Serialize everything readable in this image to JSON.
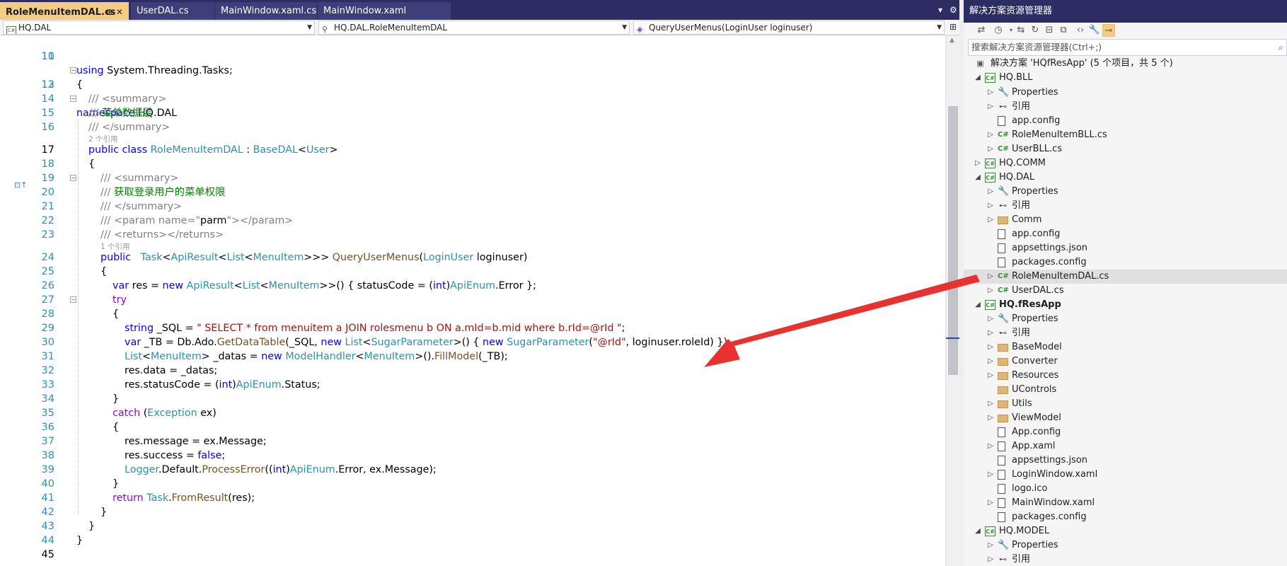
{
  "tabs": [
    {
      "label": "RoleMenuItemDAL.cs",
      "pin": "⊕ ✕"
    },
    {
      "label": "UserDAL.cs"
    },
    {
      "label": "MainWindow.xaml.cs"
    },
    {
      "label": "MainWindow.xaml"
    }
  ],
  "nav": {
    "project": "HQ.DAL",
    "type": "HQ.DAL.RoleMenuItemDAL",
    "member": "QueryUserMenus(LoginUser loginuser)"
  },
  "code": {
    "l10": "using System.Threading.Tasks;",
    "l12": "namespace HQ.DAL",
    "l13": "{",
    "l14": "/// <summary>",
    "l15_pre": "/// ",
    "l15_text": "菜单数据层",
    "l16": "/// </summary>",
    "lens1": "2 个引用",
    "l17_a": "public class ",
    "l17_b": "RoleMenuItemDAL",
    "l17_c": " : ",
    "l17_d": "BaseDAL",
    "l17_e": "<",
    "l17_f": "User",
    "l17_g": ">",
    "l18": "{",
    "l19": "/// <summary>",
    "l20_pre": "/// ",
    "l20_text": "获取登录用户的菜单权限",
    "l21": "/// </summary>",
    "l22_a": "/// <param name=\"",
    "l22_b": "parm",
    "l22_c": "\"></param>",
    "l23": "/// <returns></returns>",
    "lens2": "1 个引用",
    "l24_a": "public   ",
    "l24_b": "Task",
    "l24_c": "<",
    "l24_d": "ApiResult",
    "l24_e": "<",
    "l24_f": "List",
    "l24_g": "<",
    "l24_h": "MenuItem",
    "l24_i": ">>> ",
    "l24_j": "QueryUserMenus",
    "l24_k": "(",
    "l24_l": "LoginUser",
    "l24_m": " loginuser)",
    "l25": "{",
    "l26_a": "var",
    " l26_b": "",
    "l26_c": "res = ",
    "l26_d": "new ",
    "l26_e": "ApiResult",
    "l26_f": "<",
    "l26_g": "List",
    "l26_h": "<",
    "l26_i": "MenuItem",
    "l26_j": ">>() { statusCode = (",
    "l26_k": "int",
    "l26_l": ")",
    "l26_m": "ApiEnum",
    ".l26_n": "",
    "l26_o": ".Error };",
    "l27": "try",
    "l28": "{",
    "l29_a": "string",
    " l29_b": "",
    "l29_c": " _SQL = ",
    "l29_d": "\" SELECT * from menuitem a JOIN rolesmenu b ON a.mId=b.mid where b.rId=@rId \"",
    "l29_e": ";",
    "l30_a": "var",
    "l30_b": " _TB = Db.Ado.",
    "l30_c": "GetDataTable",
    "l30_d": "(_SQL, ",
    "l30_e": "new ",
    "l30_f": "List",
    "l30_g": "<",
    "l30_h": "SugarParameter",
    "l30_i": ">() { ",
    "l30_j": "new ",
    "l30_k": "SugarParameter",
    "l30_l": "(",
    "l30_m": "\"@rId\"",
    "l30_n": ", loginuser.roleId) });",
    "l31_a": "List",
    "l31_b": "<",
    "l31_c": "MenuItem",
    "l31_d": "> _datas = ",
    "l31_e": "new ",
    "l31_f": "ModelHandler",
    "l31_g": "<",
    "l31_h": "MenuItem",
    "l31_i": ">().",
    "l31_j": "FillModel",
    "l31_k": "(_TB);",
    "l32": "res.data = _datas;",
    "l33_a": "res.statusCode = (",
    "l33_b": "int",
    "l33_c": ")",
    "l33_d": "ApiEnum",
    "l33_e": ".Status;",
    "l34": "}",
    "l35_a": "catch ",
    "l35_b": "(",
    "l35_c": "Exception",
    "l35_d": " ex)",
    "l36": "{",
    "l37": "res.message = ex.Message;",
    "l38_a": "res.success = ",
    "l38_b": "false",
    ";l38_c": "",
    "l38_d": ";",
    "l39_a": "Logger",
    "l39_b": ".Default.",
    "l39_c": "ProcessError",
    "l39_d": "((",
    "l39_e": "int",
    "l39_f": ")",
    "l39_g": "ApiEnum",
    "l39_h": ".Error, ex.Message);",
    "l40": "}",
    "l41_a": "return ",
    "l41_b": "Task",
    "l41_c": ".",
    "l41_d": "FromResult",
    "l41_e": "(res);",
    "l42": "}",
    "l43": "}",
    "l44": "}"
  },
  "line_numbers": [
    "10",
    "11",
    "12",
    "13",
    "14",
    "15",
    "16",
    "17",
    "18",
    "19",
    "20",
    "21",
    "22",
    "23",
    "24",
    "25",
    "26",
    "27",
    "28",
    "29",
    "30",
    "31",
    "32",
    "33",
    "34",
    "35",
    "36",
    "37",
    "38",
    "39",
    "40",
    "41",
    "42",
    "43",
    "44",
    "45"
  ],
  "solution": {
    "title": "解决方案资源管理器",
    "search_placeholder": "搜索解决方案资源管理器(Ctrl+;)",
    "root": "解决方案 'HQfResApp' (5 个项目，共 5 个)",
    "items": [
      {
        "label": "HQ.BLL"
      },
      {
        "label": "Properties"
      },
      {
        "label": "引用"
      },
      {
        "label": "app.config"
      },
      {
        "label": "RoleMenuItemBLL.cs"
      },
      {
        "label": "UserBLL.cs"
      },
      {
        "label": "HQ.COMM"
      },
      {
        "label": "HQ.DAL"
      },
      {
        "label": "Properties"
      },
      {
        "label": "引用"
      },
      {
        "label": "Comm"
      },
      {
        "label": "app.config"
      },
      {
        "label": "appsettings.json"
      },
      {
        "label": "packages.config"
      },
      {
        "label": "RoleMenuItemDAL.cs"
      },
      {
        "label": "UserDAL.cs"
      },
      {
        "label": "HQ.fResApp"
      },
      {
        "label": "Properties"
      },
      {
        "label": "引用"
      },
      {
        "label": "BaseModel"
      },
      {
        "label": "Converter"
      },
      {
        "label": "Resources"
      },
      {
        "label": "UControls"
      },
      {
        "label": "Utils"
      },
      {
        "label": "ViewModel"
      },
      {
        "label": "App.config"
      },
      {
        "label": "App.xaml"
      },
      {
        "label": "appsettings.json"
      },
      {
        "label": "LoginWindow.xaml"
      },
      {
        "label": "logo.ico"
      },
      {
        "label": "MainWindow.xaml"
      },
      {
        "label": "packages.config"
      },
      {
        "label": "HQ.MODEL"
      },
      {
        "label": "Properties"
      },
      {
        "label": "引用"
      }
    ]
  },
  "colors": {
    "accent": "#2d2d63",
    "active_tab": "#f5cc84",
    "arrow": "#e8322f"
  }
}
